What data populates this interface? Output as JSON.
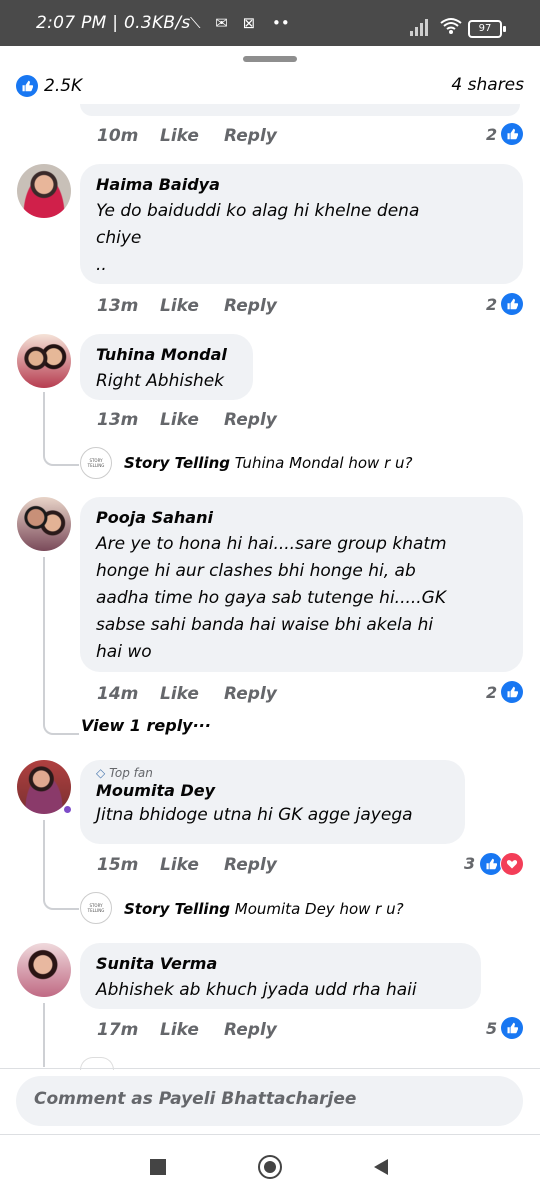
{
  "status_bar": {
    "time": "2:07 PM | 0.3KB/s",
    "battery": "97"
  },
  "post": {
    "reaction_count": "2.5K",
    "shares": "4 shares"
  },
  "colors": {
    "accent": "#1877f2",
    "heart": "#f33e58",
    "bubble": "#f0f2f5"
  },
  "first_meta": {
    "time": "10m",
    "like": "Like",
    "reply": "Reply",
    "count": "2"
  },
  "comments": [
    {
      "name": "Haima Baidya",
      "lines": [
        "Ye do baiduddi ko alag hi khelne dena",
        "chiye",
        ".."
      ],
      "time": "13m",
      "like": "Like",
      "reply": "Reply",
      "count": "2"
    },
    {
      "name": "Tuhina Mondal",
      "lines": [
        "Right Abhishek"
      ],
      "time": "13m",
      "like": "Like",
      "reply": "Reply",
      "reply_item": {
        "author": "Story Telling",
        "text": "Tuhina Mondal how r u?"
      }
    },
    {
      "name": "Pooja Sahani",
      "lines": [
        "Are ye to hona hi hai....sare group khatm",
        "honge hi aur clashes bhi honge hi, ab",
        "aadha time ho gaya sab tutenge hi.....GK",
        "sabse sahi banda hai waise bhi akela hi",
        "hai wo"
      ],
      "time": "14m",
      "like": "Like",
      "reply": "Reply",
      "count": "2",
      "view_replies": "View 1 reply···"
    },
    {
      "badge": "Top fan",
      "name": "Moumita Dey",
      "lines": [
        "Jitna bhidoge utna hi GK agge jayega"
      ],
      "time": "15m",
      "like": "Like",
      "reply": "Reply",
      "count": "3",
      "reply_item": {
        "author": "Story Telling",
        "text": "Moumita Dey how r u?"
      }
    },
    {
      "name": "Sunita Verma",
      "lines": [
        "Abhishek ab khuch jyada udd rha haii"
      ],
      "time": "17m",
      "like": "Like",
      "reply": "Reply",
      "count": "5"
    }
  ],
  "story_avatar_text": "STORY TELLING",
  "comment_box": {
    "placeholder": "Comment as Payeli Bhattacharjee"
  },
  "nav": [
    "recent-apps",
    "home",
    "back"
  ]
}
